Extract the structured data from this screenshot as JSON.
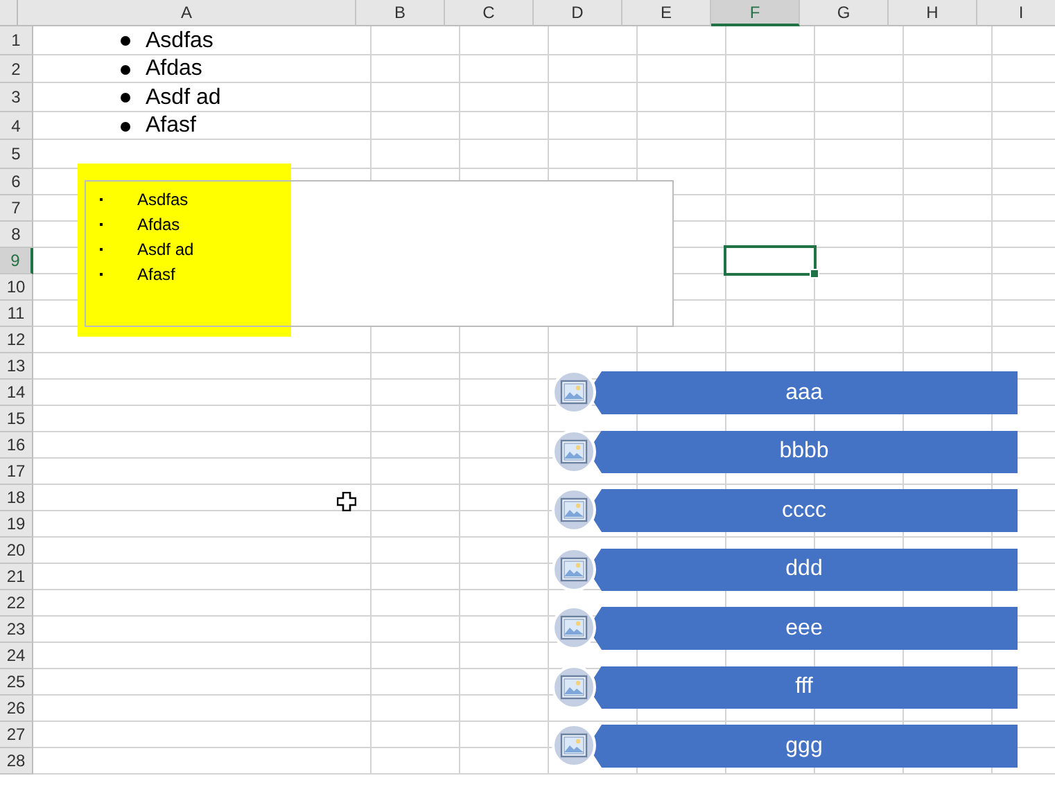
{
  "sheet": {
    "columns": [
      {
        "label": "A",
        "selected": false
      },
      {
        "label": "B",
        "selected": false
      },
      {
        "label": "C",
        "selected": false
      },
      {
        "label": "D",
        "selected": false
      },
      {
        "label": "E",
        "selected": false
      },
      {
        "label": "F",
        "selected": true
      },
      {
        "label": "G",
        "selected": false
      },
      {
        "label": "H",
        "selected": false
      },
      {
        "label": "I",
        "selected": false
      }
    ],
    "rows": [
      {
        "label": "1",
        "selected": false,
        "bullet_text": "Asdfas"
      },
      {
        "label": "2",
        "selected": false,
        "bullet_text": "Afdas"
      },
      {
        "label": "3",
        "selected": false,
        "bullet_text": "Asdf ad"
      },
      {
        "label": "4",
        "selected": false,
        "bullet_text": "Afasf"
      },
      {
        "label": "5",
        "selected": false
      },
      {
        "label": "6",
        "selected": false
      },
      {
        "label": "7",
        "selected": false
      },
      {
        "label": "8",
        "selected": false
      },
      {
        "label": "9",
        "selected": true
      },
      {
        "label": "10",
        "selected": false
      },
      {
        "label": "11",
        "selected": false
      },
      {
        "label": "12",
        "selected": false
      },
      {
        "label": "13",
        "selected": false
      },
      {
        "label": "14",
        "selected": false
      },
      {
        "label": "15",
        "selected": false
      },
      {
        "label": "16",
        "selected": false
      },
      {
        "label": "17",
        "selected": false
      },
      {
        "label": "18",
        "selected": false
      },
      {
        "label": "19",
        "selected": false
      },
      {
        "label": "20",
        "selected": false
      },
      {
        "label": "21",
        "selected": false
      },
      {
        "label": "22",
        "selected": false
      },
      {
        "label": "23",
        "selected": false
      },
      {
        "label": "24",
        "selected": false
      },
      {
        "label": "25",
        "selected": false
      },
      {
        "label": "26",
        "selected": false
      },
      {
        "label": "27",
        "selected": false
      },
      {
        "label": "28",
        "selected": false
      }
    ]
  },
  "text_box": {
    "items": [
      "Asdfas",
      "Afdas",
      "Asdf ad",
      "Afasf"
    ]
  },
  "picture_list": {
    "items": [
      "aaa",
      "bbbb",
      "cccc",
      "ddd",
      "eee",
      "fff",
      "ggg"
    ]
  }
}
